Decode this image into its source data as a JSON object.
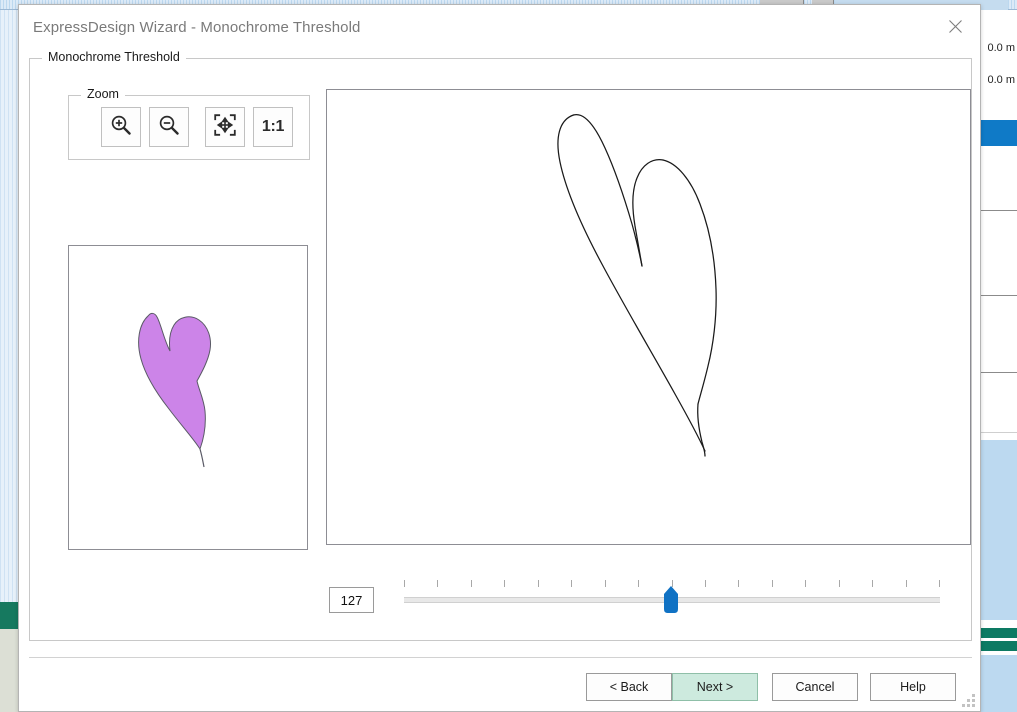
{
  "dialog": {
    "title": "ExpressDesign Wizard - Monochrome Threshold",
    "close_icon": "close-icon"
  },
  "group_main": {
    "label": "Monochrome Threshold"
  },
  "group_zoom": {
    "label": "Zoom",
    "buttons": [
      {
        "name": "zoom-in",
        "icon": "zoom-in-icon",
        "label": ""
      },
      {
        "name": "zoom-out",
        "icon": "zoom-out-icon",
        "label": ""
      },
      {
        "name": "fit-to-window",
        "icon": "fit-to-window-icon",
        "label": ""
      },
      {
        "name": "actual-size",
        "icon": "one-to-one-icon",
        "label": "1:1"
      }
    ]
  },
  "threshold": {
    "value": "127",
    "min": 0,
    "max": 255,
    "tick_count": 17,
    "thumb_color": "#1072c4",
    "track_color": "#e8e8e8"
  },
  "previews": {
    "small": {
      "name": "threshold-result-preview",
      "fill_color": "#cc84e8",
      "stroke_color": "#555555"
    },
    "main": {
      "name": "source-image-preview",
      "stroke_color": "#1a1a1a"
    }
  },
  "footer": {
    "buttons": [
      {
        "label": "< Back",
        "name": "back-button",
        "primary": false
      },
      {
        "label": "Next >",
        "name": "next-button",
        "primary": true
      },
      {
        "label": "Cancel",
        "name": "cancel-button",
        "primary": false
      },
      {
        "label": "Help",
        "name": "help-button",
        "primary": false
      }
    ]
  },
  "background": {
    "measurements": [
      "0.0 m",
      "0.0 m"
    ],
    "accent_blue": "#0f7ac7",
    "accent_teal": "#0d7a63",
    "panel_light_blue": "#bcd9f0"
  }
}
